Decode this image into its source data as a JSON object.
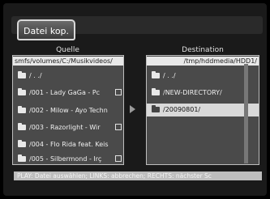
{
  "dialog": {
    "title": "Datei kop."
  },
  "source": {
    "header": "Quelle",
    "path": "smfs/volumes/C:/Musikvideos/",
    "items": [
      {
        "label": "/ . ./"
      },
      {
        "label": "/001 - Lady GaGa - Pc"
      },
      {
        "label": "/002 - Milow - Ayo Techn"
      },
      {
        "label": "/003 - Razorlight - Wir"
      },
      {
        "label": "/004 - Flo Rida feat. Keis"
      },
      {
        "label": "/005 - Silbermond - Irç"
      }
    ]
  },
  "destination": {
    "header": "Destination",
    "path": "/tmp/hddmedia/HDD1/",
    "items": [
      {
        "label": "/ . ./"
      },
      {
        "label": "/NEW-DIRECTORY/"
      },
      {
        "label": "/20090801/"
      }
    ]
  },
  "status_bar": {
    "text": "PLAY: Datei auswählen; LINKS: abbrechen; RECHTS: nächster Sc"
  },
  "icons": {
    "folder": "folder-icon",
    "arrow": "arrow-right-icon",
    "checkbox": "checkbox-icon"
  }
}
